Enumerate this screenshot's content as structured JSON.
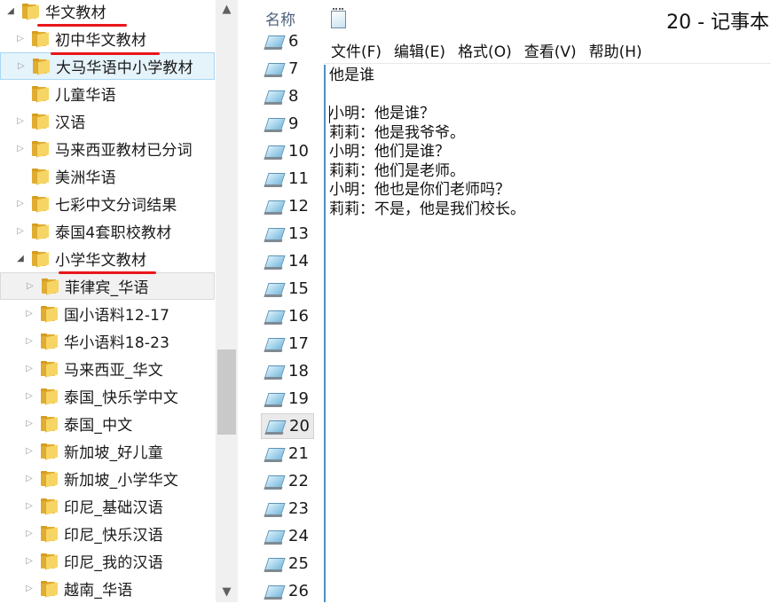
{
  "tree": {
    "items": [
      {
        "label": "华文教材",
        "level": 0,
        "arrow": "open"
      },
      {
        "label": "初中华文教材",
        "level": 1,
        "arrow": "closed"
      },
      {
        "label": "大马华语中小学教材",
        "level": 1,
        "arrow": "closed"
      },
      {
        "label": "儿童华语",
        "level": 1,
        "arrow": "none"
      },
      {
        "label": "汉语",
        "level": 1,
        "arrow": "closed"
      },
      {
        "label": "马来西亚教材已分词",
        "level": 1,
        "arrow": "closed"
      },
      {
        "label": "美洲华语",
        "level": 1,
        "arrow": "none"
      },
      {
        "label": "七彩中文分词结果",
        "level": 1,
        "arrow": "closed"
      },
      {
        "label": "泰国4套职校教材",
        "level": 1,
        "arrow": "closed"
      },
      {
        "label": "小学华文教材",
        "level": 1,
        "arrow": "open"
      },
      {
        "label": "菲律宾_华语",
        "level": 2,
        "arrow": "closed"
      },
      {
        "label": "国小语料12-17",
        "level": 2,
        "arrow": "closed"
      },
      {
        "label": "华小语料18-23",
        "level": 2,
        "arrow": "closed"
      },
      {
        "label": "马来西亚_华文",
        "level": 2,
        "arrow": "closed"
      },
      {
        "label": "泰国_快乐学中文",
        "level": 2,
        "arrow": "closed"
      },
      {
        "label": "泰国_中文",
        "level": 2,
        "arrow": "closed"
      },
      {
        "label": "新加坡_好儿童",
        "level": 2,
        "arrow": "closed"
      },
      {
        "label": "新加坡_小学华文",
        "level": 2,
        "arrow": "closed"
      },
      {
        "label": "印尼_基础汉语",
        "level": 2,
        "arrow": "closed"
      },
      {
        "label": "印尼_快乐汉语",
        "level": 2,
        "arrow": "closed"
      },
      {
        "label": "印尼_我的汉语",
        "level": 2,
        "arrow": "closed"
      },
      {
        "label": "越南_华语",
        "level": 2,
        "arrow": "closed"
      }
    ]
  },
  "scrollbar": {
    "up_icon": "▲",
    "down_icon": "▼"
  },
  "files": {
    "column_header": "名称",
    "items": [
      "6",
      "7",
      "8",
      "9",
      "10",
      "11",
      "12",
      "13",
      "14",
      "15",
      "16",
      "17",
      "18",
      "19",
      "20",
      "21",
      "22",
      "23",
      "24",
      "25",
      "26"
    ],
    "selected": "20"
  },
  "notepad": {
    "title": "20 - 记事本",
    "menu": [
      "文件(F)",
      "编辑(E)",
      "格式(O)",
      "查看(V)",
      "帮助(H)"
    ],
    "content": "他是谁\n\n小明：他是谁？\n莉莉：他是我爷爷。\n小明：他们是谁？\n莉莉：他们是老师。\n小明：他也是你们老师吗？\n莉莉：不是，他是我们校长。"
  },
  "colors": {
    "annotation_underline": "#e8161a",
    "hover_highlight": "#e5f3fb",
    "selection_highlight": "#eaeaea",
    "folder_yellow": "#f7d564"
  }
}
